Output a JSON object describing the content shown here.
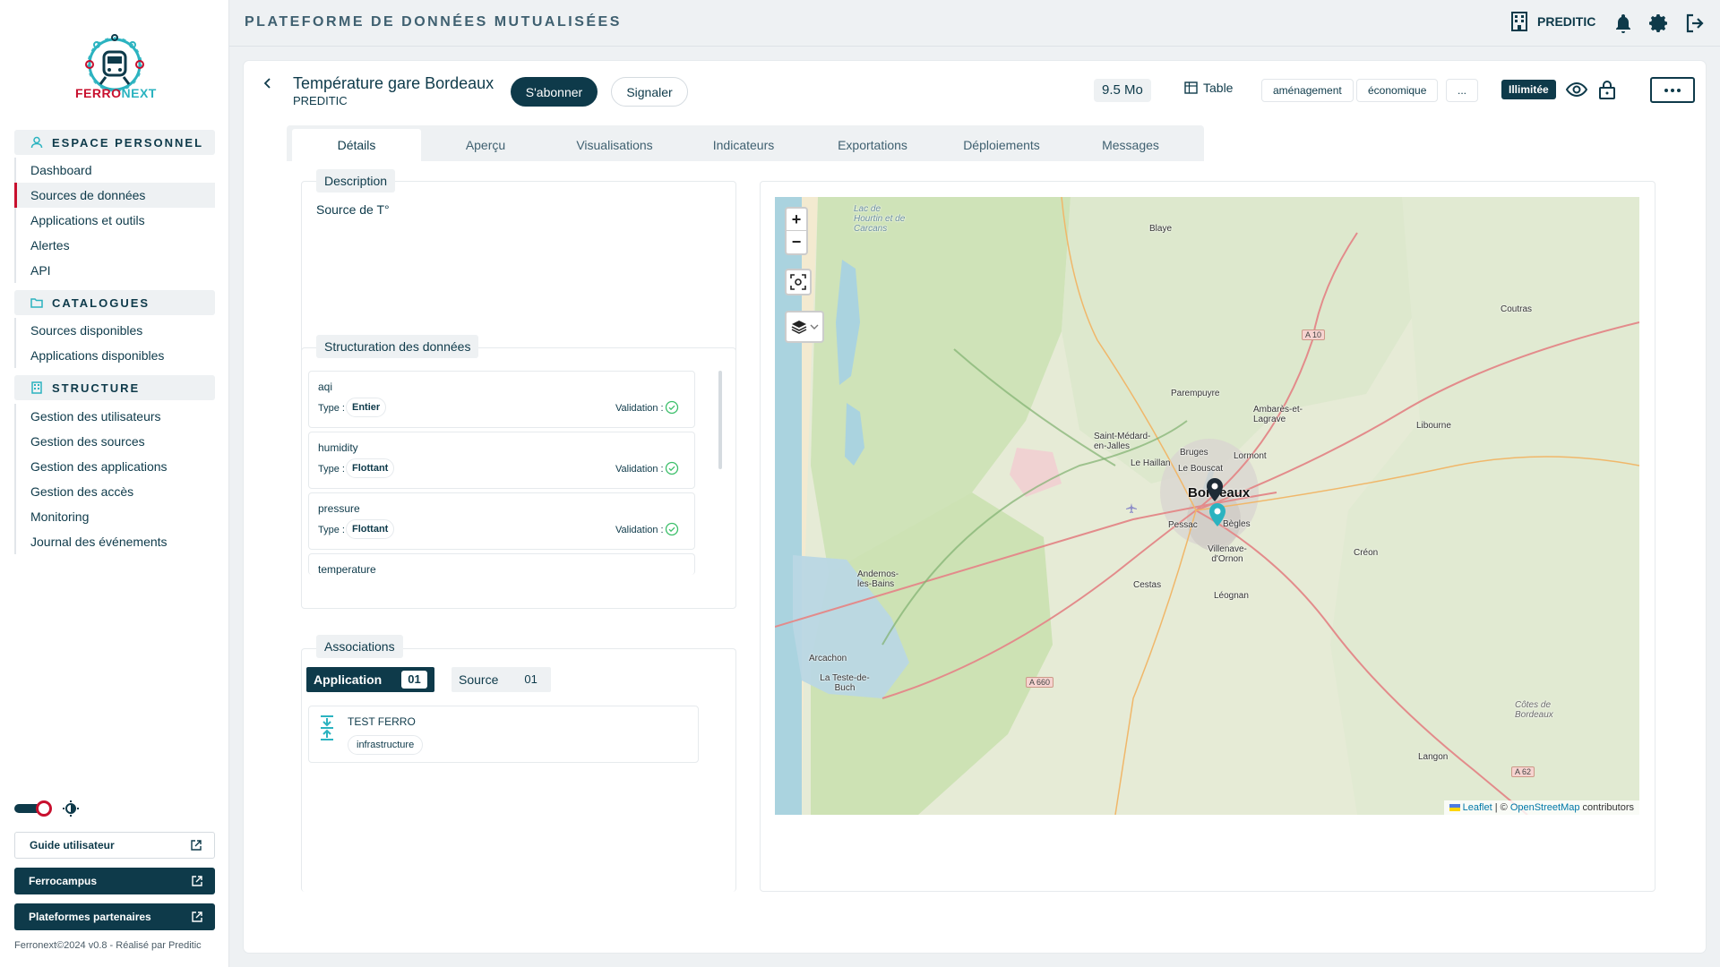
{
  "brand": {
    "logo_part1": "FERRO",
    "logo_part2": "NEXT"
  },
  "topbar": {
    "title": "PLATEFORME DE DONNÉES MUTUALISÉES",
    "org": "PREDITIC"
  },
  "sidebar": {
    "sections": [
      {
        "title": "ESPACE PERSONNEL",
        "icon": "user-icon",
        "items": [
          "Dashboard",
          "Sources de données",
          "Applications et outils",
          "Alertes",
          "API"
        ]
      },
      {
        "title": "CATALOGUES",
        "icon": "folder-icon",
        "items": [
          "Sources disponibles",
          "Applications disponibles"
        ]
      },
      {
        "title": "STRUCTURE",
        "icon": "building-icon",
        "items": [
          "Gestion des utilisateurs",
          "Gestion des sources",
          "Gestion des applications",
          "Gestion des accès",
          "Monitoring",
          "Journal des événements"
        ]
      }
    ],
    "active_item": "Sources de données",
    "buttons": [
      "Guide utilisateur",
      "Ferrocampus",
      "Plateformes partenaires"
    ],
    "footer": "Ferronext©2024 v0.8 - Réalisé par Preditic"
  },
  "dataset": {
    "title": "Température gare Bordeaux",
    "owner": "PREDITIC",
    "subscribe_label": "S'abonner",
    "report_label": "Signaler",
    "size": "9.5 Mo",
    "format": "Table",
    "tags": [
      "aménagement",
      "économique",
      "..."
    ],
    "access_badge": "Illimitée"
  },
  "tabs": [
    "Détails",
    "Aperçu",
    "Visualisations",
    "Indicateurs",
    "Exportations",
    "Déploiements",
    "Messages"
  ],
  "active_tab": "Détails",
  "description": {
    "label": "Description",
    "text": "Source de T°"
  },
  "structure": {
    "label": "Structuration des données",
    "type_label": "Type :",
    "validation_label": "Validation :",
    "fields": [
      {
        "name": "aqi",
        "type": "Entier",
        "valid": true
      },
      {
        "name": "humidity",
        "type": "Flottant",
        "valid": true
      },
      {
        "name": "pressure",
        "type": "Flottant",
        "valid": true
      },
      {
        "name": "temperature",
        "type": "",
        "valid": true
      }
    ]
  },
  "associations": {
    "label": "Associations",
    "tabs": [
      {
        "label": "Application",
        "count": "01"
      },
      {
        "label": "Source",
        "count": "01"
      }
    ],
    "items": [
      {
        "name": "TEST FERRO",
        "tag": "infrastructure"
      }
    ]
  },
  "map": {
    "zoom_in": "+",
    "zoom_out": "−",
    "attribution_leaflet": "Leaflet",
    "attribution_sep": " | © ",
    "attribution_osm": "OpenStreetMap",
    "attribution_tail": " contributors",
    "places": [
      "Lac de Hourtin et de Carcans",
      "Blaye",
      "Coutras",
      "Parempuyre",
      "Ambarès-et-Lagrave",
      "Libourne",
      "Saint-Médard-en-Jalles",
      "Bruges",
      "Lormont",
      "Le Haillan",
      "Le Bouscat",
      "Bordeaux",
      "Pessac",
      "Bègles",
      "Villenave-d'Ornon",
      "Andernos-les-Bains",
      "Créon",
      "Cestas",
      "Léognan",
      "Arcachon",
      "La Teste-de-Buch",
      "Côtes de Bordeaux",
      "Langon"
    ],
    "roads": [
      "A 10",
      "A 660",
      "A 62"
    ]
  }
}
